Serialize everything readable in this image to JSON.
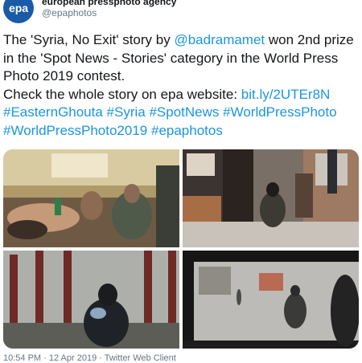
{
  "account": {
    "display_name": "european pressphoto agency",
    "handle": "@epaphotos",
    "avatar_text": "epa",
    "brand_color": "#1a5aa6"
  },
  "tweet": {
    "text_before_mention": "The 'Syria, No Exit' story by ",
    "mention": "@badramamet",
    "text_after_mention": " won 2nd prize in the 'Spot News - Stories' category in the World Press Photo 2019 contest.",
    "line2_text": "Check the whole story on epa website: ",
    "url": "bit.ly/2UTEr8N",
    "hashtags": [
      "#EasternGhouta",
      "#Syria",
      "#SpotNews",
      "#WorldPressPhoto",
      "#WorldPressPhoto2019",
      "#epaphotos"
    ],
    "link_color": "#1b95e0"
  },
  "meta": {
    "timestamp": "10:54 PM · 12 Apr 2019 · Twitter Web Client"
  }
}
